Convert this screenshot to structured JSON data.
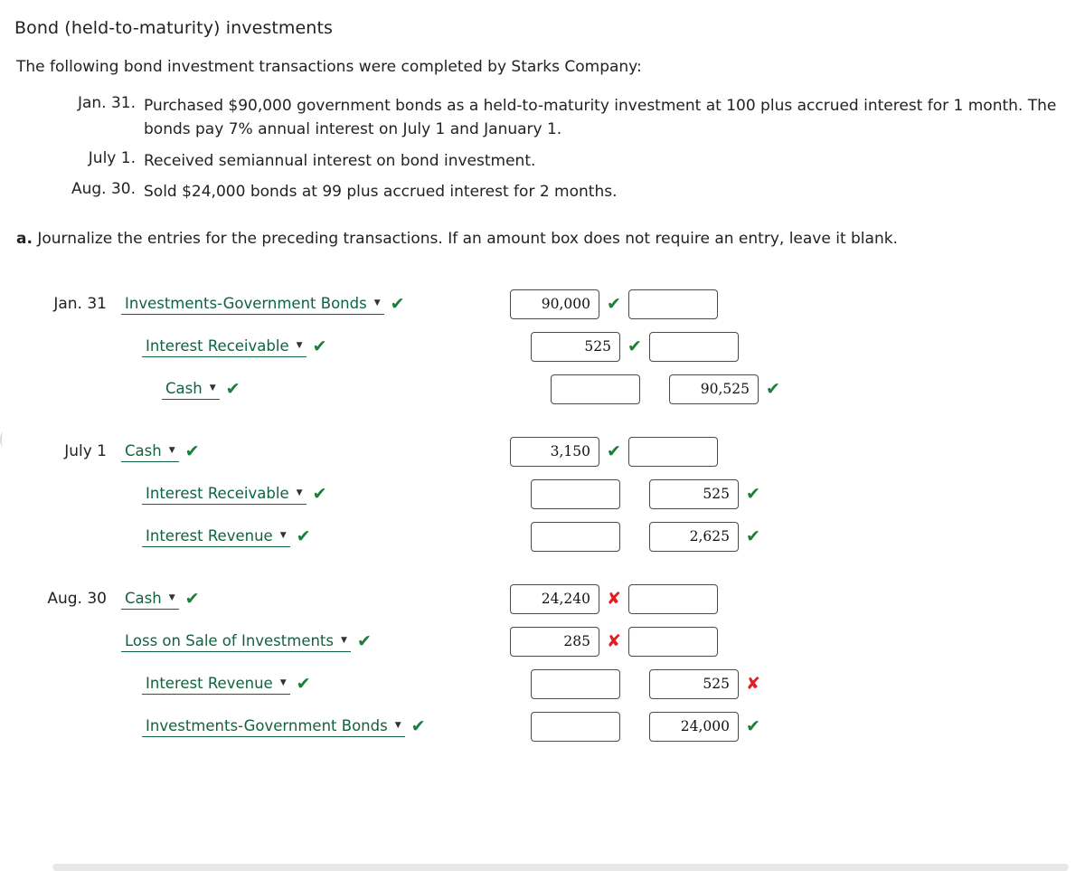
{
  "document": {
    "title": "Bond (held-to-maturity) investments",
    "intro": "The following bond investment transactions were completed by Starks Company:",
    "transactions": [
      {
        "date": "Jan. 31.",
        "description": "Purchased $90,000 government bonds as a held-to-maturity investment at 100 plus accrued interest for 1 month. The bonds pay 7% annual interest on July 1 and January 1."
      },
      {
        "date": "July 1.",
        "description": "Received semiannual interest on bond investment."
      },
      {
        "date": "Aug. 30.",
        "description": "Sold $24,000 bonds at 99 plus accrued interest for 2 months."
      }
    ],
    "requirement_label": "a.",
    "requirement_text": "Journalize the entries for the preceding transactions. If an amount box does not require an entry, leave it blank."
  },
  "journal": {
    "entries": [
      {
        "date": "Jan. 31",
        "lines": [
          {
            "indent": 0,
            "account": "Investments-Government Bonds",
            "account_mark": "check",
            "debit": "90,000",
            "debit_mark": "check",
            "credit": "",
            "credit_mark": "none"
          },
          {
            "indent": 1,
            "account": "Interest Receivable",
            "account_mark": "check",
            "debit": "525",
            "debit_mark": "check",
            "credit": "",
            "credit_mark": "none"
          },
          {
            "indent": 2,
            "account": "Cash",
            "account_mark": "check",
            "debit": "",
            "debit_mark": "none",
            "credit": "90,525",
            "credit_mark": "check"
          }
        ]
      },
      {
        "date": "July 1",
        "lines": [
          {
            "indent": 0,
            "account": "Cash",
            "account_mark": "check",
            "debit": "3,150",
            "debit_mark": "check",
            "credit": "",
            "credit_mark": "none"
          },
          {
            "indent": 1,
            "account": "Interest Receivable",
            "account_mark": "check",
            "debit": "",
            "debit_mark": "none",
            "credit": "525",
            "credit_mark": "check"
          },
          {
            "indent": 1,
            "account": "Interest Revenue",
            "account_mark": "check",
            "debit": "",
            "debit_mark": "none",
            "credit": "2,625",
            "credit_mark": "check"
          }
        ]
      },
      {
        "date": "Aug. 30",
        "lines": [
          {
            "indent": 0,
            "account": "Cash",
            "account_mark": "check",
            "debit": "24,240",
            "debit_mark": "cross",
            "credit": "",
            "credit_mark": "none"
          },
          {
            "indent": 0,
            "account": "Loss on Sale of Investments",
            "account_mark": "check",
            "debit": "285",
            "debit_mark": "cross",
            "credit": "",
            "credit_mark": "none"
          },
          {
            "indent": 1,
            "account": "Interest Revenue",
            "account_mark": "check",
            "debit": "",
            "debit_mark": "none",
            "credit": "525",
            "credit_mark": "cross"
          },
          {
            "indent": 1,
            "account": "Investments-Government Bonds",
            "account_mark": "check",
            "debit": "",
            "debit_mark": "none",
            "credit": "24,000",
            "credit_mark": "check"
          }
        ]
      }
    ]
  },
  "symbols": {
    "check": "✔",
    "cross": "✘",
    "caret": "▼"
  },
  "colors": {
    "link_green": "#10633f",
    "check_green": "#1a7f37",
    "cross_red": "#e02020"
  }
}
